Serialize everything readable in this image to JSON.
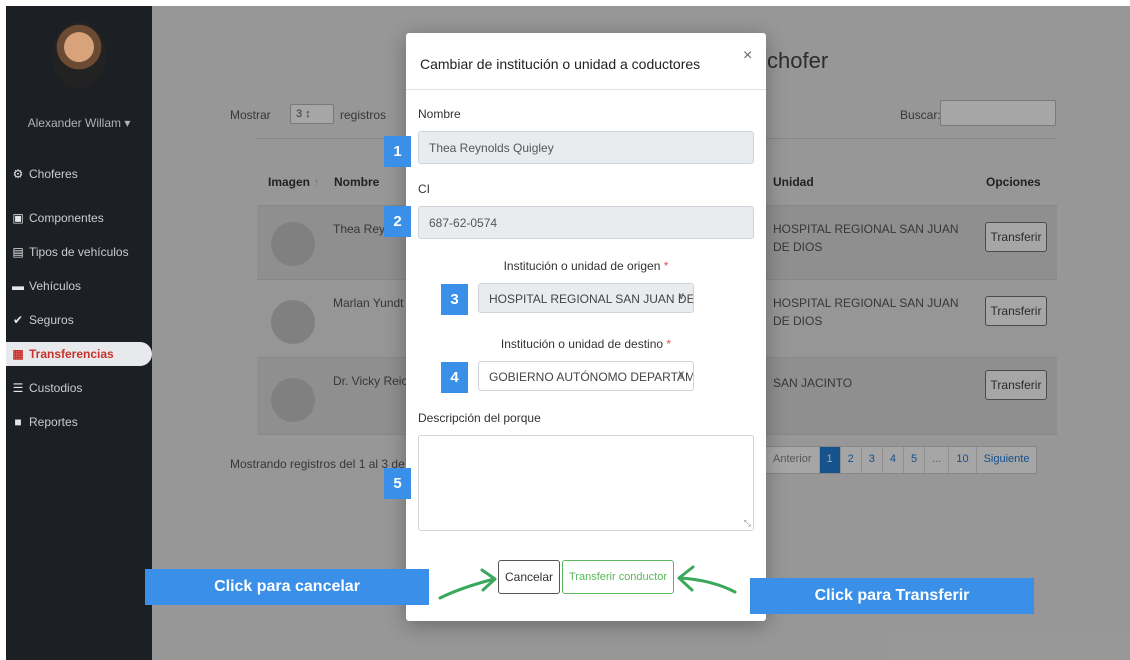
{
  "sidebar": {
    "user_name": "Alexander Willam ▾",
    "items": [
      {
        "label": "Choferes",
        "icon": "steering-wheel-icon",
        "glyph": "⚙"
      },
      {
        "label": "Componentes",
        "icon": "component-icon",
        "glyph": "▣"
      },
      {
        "label": "Tipos de vehículos",
        "icon": "bus-icon",
        "glyph": "▤"
      },
      {
        "label": "Vehículos",
        "icon": "car-icon",
        "glyph": "▬"
      },
      {
        "label": "Seguros",
        "icon": "shield-check-icon",
        "glyph": "✔"
      },
      {
        "label": "Transferencias",
        "icon": "transfer-icon",
        "glyph": "▦",
        "active": true
      },
      {
        "label": "Custodios",
        "icon": "document-list-icon",
        "glyph": "☰"
      },
      {
        "label": "Reportes",
        "icon": "file-icon",
        "glyph": "■"
      }
    ]
  },
  "page": {
    "title": "chofer",
    "show_label": "Mostrar",
    "show_value": "3",
    "show_suffix": "registros",
    "search_label": "Buscar:",
    "columns": {
      "image": "Imagen",
      "name": "Nombre",
      "unit": "Unidad",
      "options": "Opciones"
    },
    "rows": [
      {
        "name": "Thea Reyn",
        "unit": "HOSPITAL REGIONAL SAN JUAN DE DIOS",
        "action": "Transferir"
      },
      {
        "name": "Marlan Yundt J",
        "unit": "HOSPITAL REGIONAL SAN JUAN DE DIOS",
        "action": "Transferir"
      },
      {
        "name": "Dr. Vicky Reich",
        "unit": "SAN JACINTO",
        "action": "Transferir"
      }
    ],
    "showing_text": "Mostrando registros del 1 al 3 de",
    "pagination": [
      "Anterior",
      "1",
      "2",
      "3",
      "4",
      "5",
      "...",
      "10",
      "Siguiente"
    ]
  },
  "modal": {
    "title": "Cambiar de institución o unidad a coductores",
    "close": "×",
    "name_label": "Nombre",
    "name_value": "Thea Reynolds Quigley",
    "ci_label": "CI",
    "ci_value": "687-62-0574",
    "origin_label": "Institución o unidad de origen",
    "origin_value": "HOSPITAL REGIONAL SAN JUAN DE DIOS",
    "destination_label": "Institución o unidad de destino",
    "destination_value": "GOBIERNO AUTÓNOMO DEPARTAMENTAL",
    "required_mark": "*",
    "description_label": "Descripción del porque",
    "cancel_label": "Cancelar",
    "submit_label": "Transferir conductor"
  },
  "annotations": {
    "steps": [
      "1",
      "2",
      "3",
      "4",
      "5"
    ],
    "cancel_callout": "Click para cancelar",
    "transfer_callout": "Click para Transferir",
    "arrow_color": "#3aa85a",
    "callout_color": "#3a8fe8"
  }
}
